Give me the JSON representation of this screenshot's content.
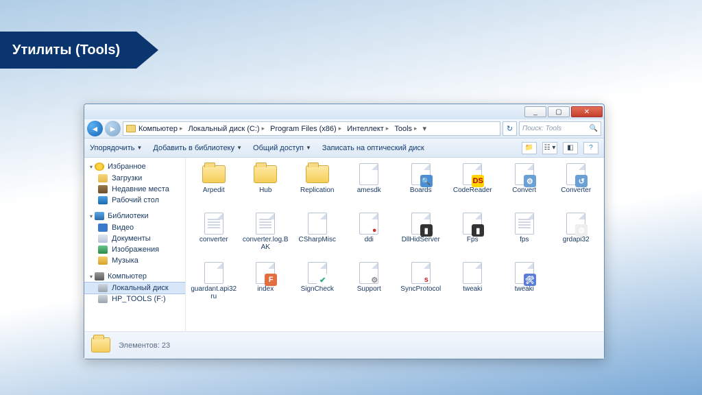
{
  "slide_title": "Утилиты (Tools)",
  "window": {
    "controls": {
      "min": "_",
      "max": "▢",
      "close": "✕"
    },
    "breadcrumb": [
      "Компьютер",
      "Локальный диск (C:)",
      "Program Files (x86)",
      "Интеллект",
      "Tools"
    ],
    "search_placeholder": "Поиск: Tools"
  },
  "toolbar": {
    "organize": "Упорядочить",
    "add_library": "Добавить в библиотеку",
    "share": "Общий доступ",
    "burn": "Записать на оптический диск"
  },
  "sidebar": {
    "favorites": {
      "header": "Избранное",
      "items": [
        "Загрузки",
        "Недавние места",
        "Рабочий стол"
      ]
    },
    "libraries": {
      "header": "Библиотеки",
      "items": [
        "Видео",
        "Документы",
        "Изображения",
        "Музыка"
      ]
    },
    "computer": {
      "header": "Компьютер",
      "items": [
        "Локальный диск",
        "HP_TOOLS (F:)"
      ]
    }
  },
  "items": [
    {
      "name": "Arpedit",
      "type": "folder"
    },
    {
      "name": "Hub",
      "type": "folder"
    },
    {
      "name": "Replication",
      "type": "folder"
    },
    {
      "name": "amesdk",
      "type": "file",
      "overlayText": "",
      "overlayBg": ""
    },
    {
      "name": "Boards",
      "type": "file",
      "overlayText": "🔍",
      "overlayBg": "#4a8fd6"
    },
    {
      "name": "CodeReader",
      "type": "file",
      "overlayText": "DS",
      "overlayBg": "#ffd400",
      "overlayColor": "#b00"
    },
    {
      "name": "Convert",
      "type": "file",
      "overlayText": "⚙",
      "overlayBg": "#6aa0d6"
    },
    {
      "name": "Converter",
      "type": "file",
      "overlayText": "↺",
      "overlayBg": "#6aa0d6"
    },
    {
      "name": "converter",
      "type": "textfile"
    },
    {
      "name": "converter.log.BAK",
      "type": "textfile"
    },
    {
      "name": "CSharpMisc",
      "type": "file",
      "overlayText": "",
      "overlayBg": ""
    },
    {
      "name": "ddi",
      "type": "file",
      "overlayText": "●",
      "overlayBg": "",
      "overlayColor": "#c33"
    },
    {
      "name": "DllHidServer",
      "type": "file",
      "overlayText": "▮",
      "overlayBg": "#333",
      "overlayColor": "#fff"
    },
    {
      "name": "Fps",
      "type": "file",
      "overlayText": "▮",
      "overlayBg": "#333",
      "overlayColor": "#fff"
    },
    {
      "name": "fps",
      "type": "textfile"
    },
    {
      "name": "grdapi32",
      "type": "file",
      "overlayText": "⚙",
      "overlayBg": "#eee"
    },
    {
      "name": "guardant.api32ru",
      "type": "file"
    },
    {
      "name": "index",
      "type": "file",
      "overlayText": "F",
      "overlayBg": "#e07040",
      "overlayColor": "#fff"
    },
    {
      "name": "SignCheck",
      "type": "file",
      "overlayText": "✔",
      "overlayBg": "#fff",
      "overlayColor": "#2a8"
    },
    {
      "name": "Support",
      "type": "file",
      "overlayText": "⚙",
      "overlayBg": "",
      "overlayColor": "#888"
    },
    {
      "name": "SyncProtocol",
      "type": "file",
      "overlayText": "s",
      "overlayBg": "",
      "overlayColor": "#c22"
    },
    {
      "name": "tweaki",
      "type": "file",
      "overlayText": "",
      "overlayBg": ""
    },
    {
      "name": "tweaki",
      "type": "file",
      "overlayText": "🛠",
      "overlayBg": "#5a7ed6",
      "overlayColor": "#fff"
    }
  ],
  "status": {
    "label": "Элементов:",
    "count": "23"
  }
}
